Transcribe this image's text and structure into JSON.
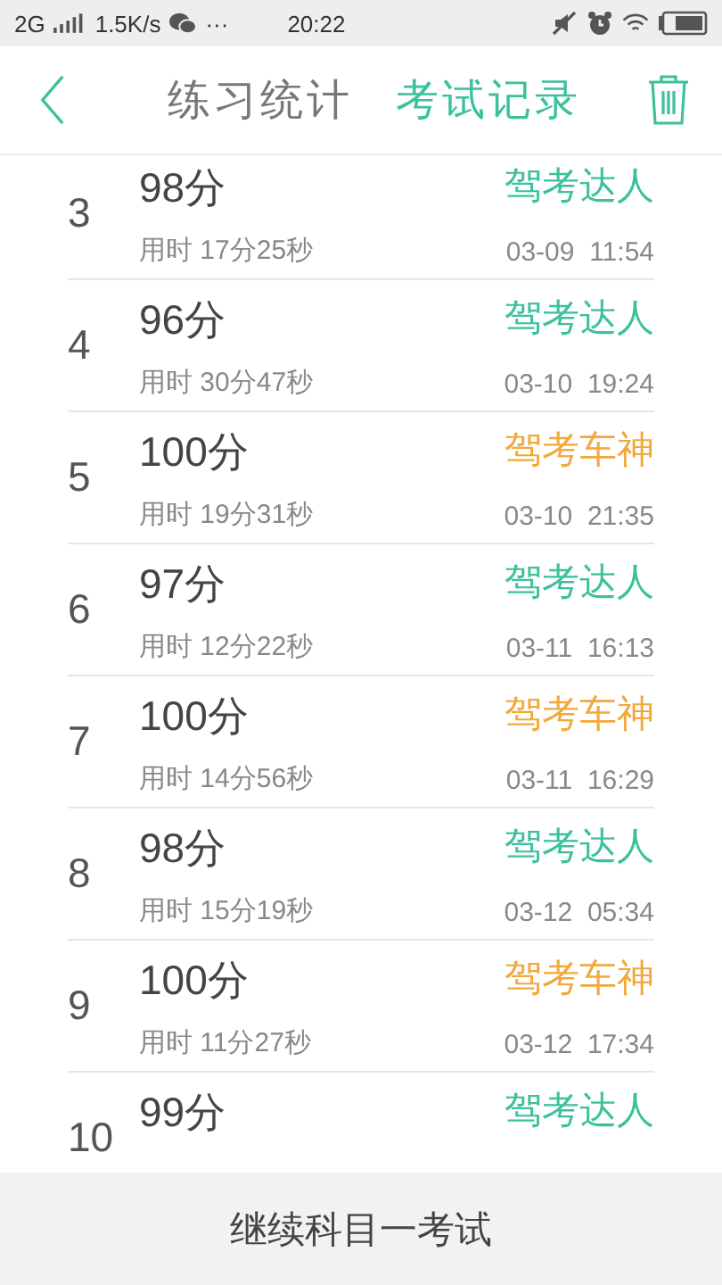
{
  "status_bar": {
    "network": "2G",
    "speed": "1.5K/s",
    "more": "···",
    "time": "20:22"
  },
  "tabs": [
    {
      "label": "练习统计",
      "selected": false
    },
    {
      "label": "考试记录",
      "selected": true
    }
  ],
  "records": [
    {
      "index": "3",
      "score": "98分",
      "duration": "用时 17分25秒",
      "badge": "驾考达人",
      "color": "#3cc19c",
      "date": "03-09  11:54"
    },
    {
      "index": "4",
      "score": "96分",
      "duration": "用时 30分47秒",
      "badge": "驾考达人",
      "color": "#3cc19c",
      "date": "03-10  19:24"
    },
    {
      "index": "5",
      "score": "100分",
      "duration": "用时 19分31秒",
      "badge": "驾考车神",
      "color": "#f2a93b",
      "date": "03-10  21:35"
    },
    {
      "index": "6",
      "score": "97分",
      "duration": "用时 12分22秒",
      "badge": "驾考达人",
      "color": "#3cc19c",
      "date": "03-11  16:13"
    },
    {
      "index": "7",
      "score": "100分",
      "duration": "用时 14分56秒",
      "badge": "驾考车神",
      "color": "#f2a93b",
      "date": "03-11  16:29"
    },
    {
      "index": "8",
      "score": "98分",
      "duration": "用时 15分19秒",
      "badge": "驾考达人",
      "color": "#3cc19c",
      "date": "03-12  05:34"
    },
    {
      "index": "9",
      "score": "100分",
      "duration": "用时 11分27秒",
      "badge": "驾考车神",
      "color": "#f2a93b",
      "date": "03-12  17:34"
    },
    {
      "index": "10",
      "score": "99分",
      "badge": "驾考达人",
      "color": "#3cc19c"
    }
  ],
  "continue_button": "继续科目一考试"
}
